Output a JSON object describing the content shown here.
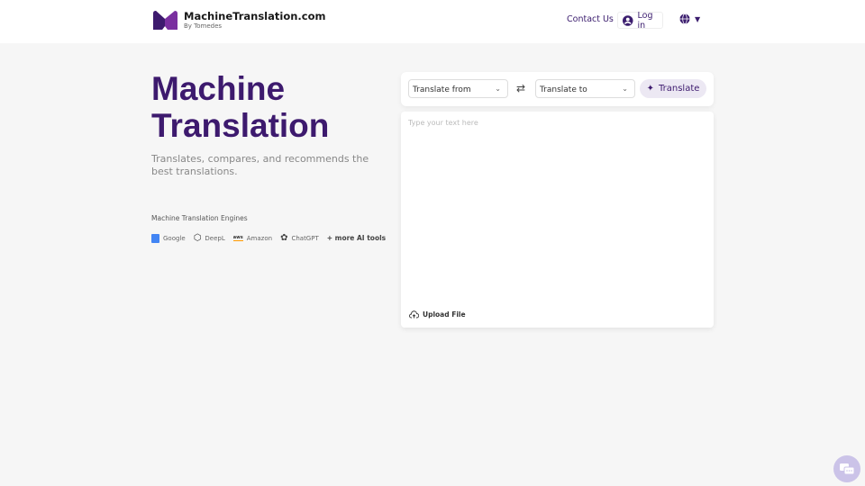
{
  "header": {
    "brand": "MachineTranslation.com",
    "byline": "By Tomedes",
    "contact": "Contact Us",
    "login": "Log in"
  },
  "hero": {
    "title_line1": "Machine",
    "title_line2": "Translation",
    "subtitle": "Translates, compares, and recommends the best translations.",
    "engines_title": "Machine Translation Engines",
    "engines": [
      {
        "name": "Google",
        "icon": "google-translate-icon"
      },
      {
        "name": "DeepL",
        "icon": "deepl-icon"
      },
      {
        "name": "Amazon",
        "icon": "aws-icon"
      },
      {
        "name": "ChatGPT",
        "icon": "openai-icon"
      }
    ],
    "more": "+ more AI tools"
  },
  "translator": {
    "from": "Translate from",
    "to": "Translate to",
    "button": "Translate",
    "placeholder": "Type your text here",
    "upload": "Upload File"
  },
  "colors": {
    "accent": "#3d1a6e",
    "button_bg": "#ece8f3",
    "chat": "#cbc3e8"
  }
}
